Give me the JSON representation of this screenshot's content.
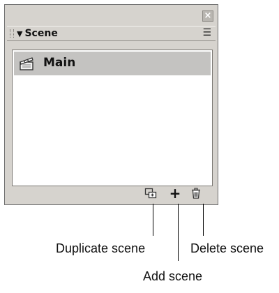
{
  "window": {
    "close_glyph": "×"
  },
  "panel": {
    "title": "Scene",
    "collapse_glyph": "▼",
    "options_glyph": "☰"
  },
  "scenes": [
    {
      "label": "Main",
      "icon": "clapperboard-icon",
      "selected": true
    }
  ],
  "toolbar": {
    "duplicate": {
      "icon": "duplicate-scene-icon"
    },
    "add": {
      "glyph": "+",
      "icon": "plus-icon"
    },
    "delete": {
      "icon": "trash-icon"
    }
  },
  "callouts": {
    "duplicate_label": "Duplicate scene",
    "add_label": "Add scene",
    "delete_label": "Delete scene"
  },
  "colors": {
    "panel_bg": "#d6d3ce",
    "selection": "#c4c3c1",
    "list_bg": "#ffffff"
  }
}
